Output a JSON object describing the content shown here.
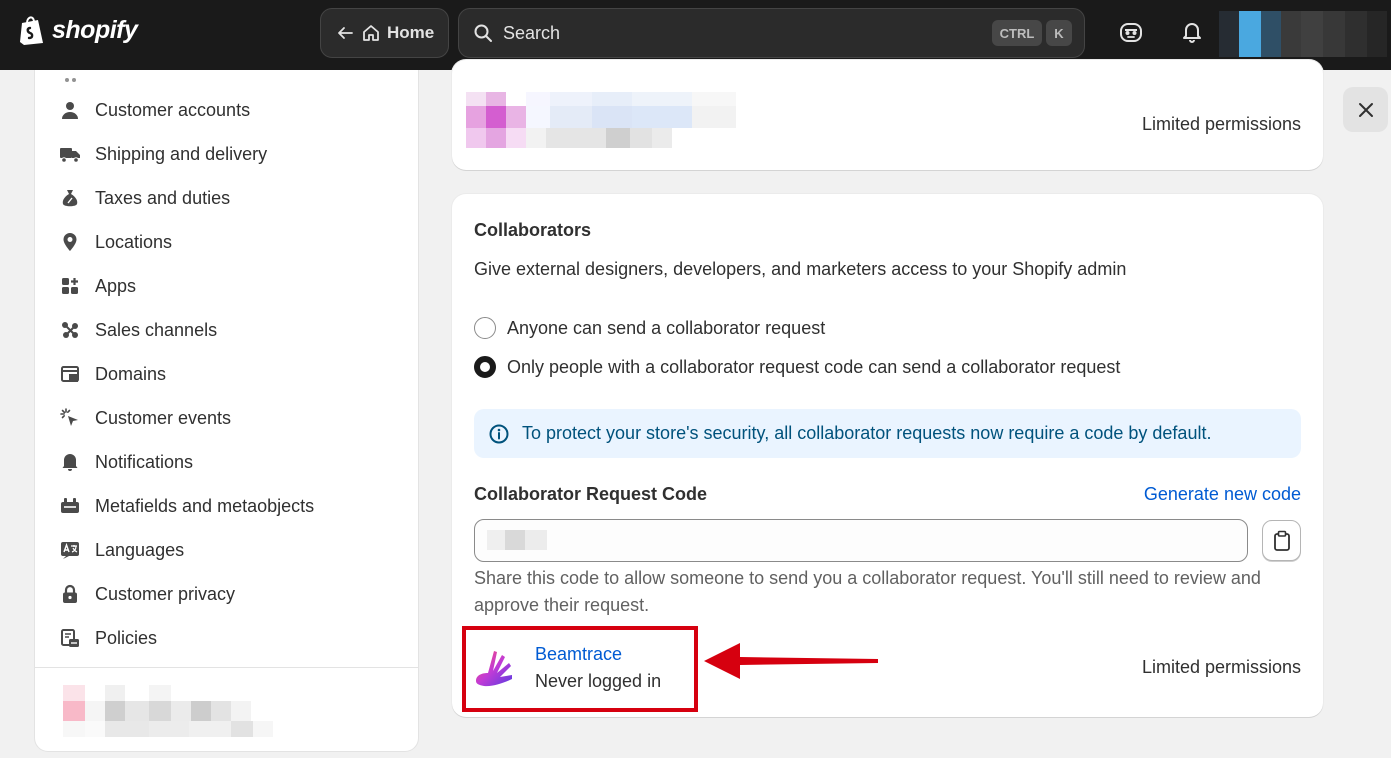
{
  "topbar": {
    "logo_text": "shopify",
    "home_label": "Home",
    "search_placeholder": "Search",
    "shortcut_ctrl": "CTRL",
    "shortcut_k": "K"
  },
  "sidebar": {
    "items": [
      {
        "label": "Customer accounts",
        "icon": "person-icon"
      },
      {
        "label": "Shipping and delivery",
        "icon": "truck-icon"
      },
      {
        "label": "Taxes and duties",
        "icon": "money-bag-icon"
      },
      {
        "label": "Locations",
        "icon": "location-pin-icon"
      },
      {
        "label": "Apps",
        "icon": "apps-icon"
      },
      {
        "label": "Sales channels",
        "icon": "sales-channels-icon"
      },
      {
        "label": "Domains",
        "icon": "domains-icon"
      },
      {
        "label": "Customer events",
        "icon": "cursor-click-icon"
      },
      {
        "label": "Notifications",
        "icon": "bell-icon"
      },
      {
        "label": "Metafields and metaobjects",
        "icon": "metafields-icon"
      },
      {
        "label": "Languages",
        "icon": "languages-icon"
      },
      {
        "label": "Customer privacy",
        "icon": "lock-icon"
      },
      {
        "label": "Policies",
        "icon": "policies-icon"
      }
    ]
  },
  "staff_card": {
    "permission": "Limited permissions"
  },
  "collaborators": {
    "title": "Collaborators",
    "description": "Give external designers, developers, and marketers access to your Shopify admin",
    "options": [
      {
        "label": "Anyone can send a collaborator request",
        "selected": false
      },
      {
        "label": "Only people with a collaborator request code can send a collaborator request",
        "selected": true
      }
    ],
    "banner": "To protect your store's security, all collaborator requests now require a code by default.",
    "code_label": "Collaborator Request Code",
    "generate_label": "Generate new code",
    "help_text": "Share this code to allow someone to send you a collaborator request. You'll still need to review and approve their request.",
    "collaborator": {
      "name": "Beamtrace",
      "status": "Never logged in",
      "permission": "Limited permissions"
    }
  },
  "colors": {
    "topbar": "#1a1a1a",
    "link": "#005bd3",
    "banner_bg": "#eaf4ff",
    "highlight": "#d6000f"
  }
}
